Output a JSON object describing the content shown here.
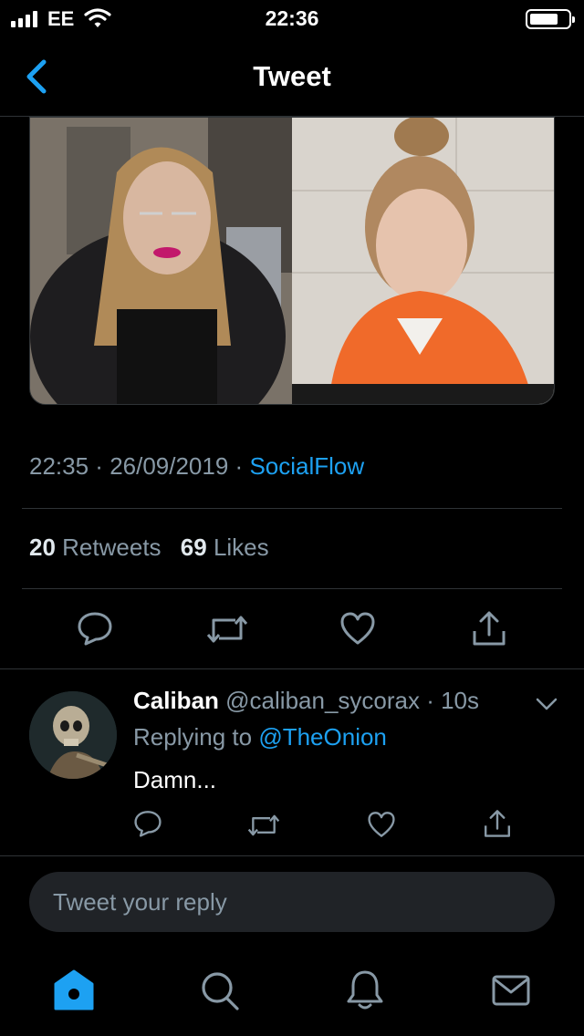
{
  "status_bar": {
    "carrier": "EE",
    "time": "22:36"
  },
  "nav": {
    "title": "Tweet"
  },
  "tweet": {
    "time": "22:35",
    "date": "26/09/2019",
    "source": "SocialFlow",
    "retweets": "20",
    "retweets_label": "Retweets",
    "likes": "69",
    "likes_label": "Likes"
  },
  "reply": {
    "name": "Caliban",
    "handle": "@caliban_sycorax",
    "age": "10s",
    "replying_prefix": "Replying to",
    "replying_to": "@TheOnion",
    "text": "Damn..."
  },
  "compose": {
    "placeholder": "Tweet your reply"
  },
  "colors": {
    "accent": "#1da1f2",
    "muted": "#8899a6",
    "background": "#000000",
    "divider": "#2f3336"
  },
  "icons": {
    "tweet_actions": [
      "reply-icon",
      "retweet-icon",
      "like-icon",
      "share-icon"
    ],
    "tab_bar": [
      "home-icon",
      "search-icon",
      "notifications-icon",
      "messages-icon"
    ]
  }
}
